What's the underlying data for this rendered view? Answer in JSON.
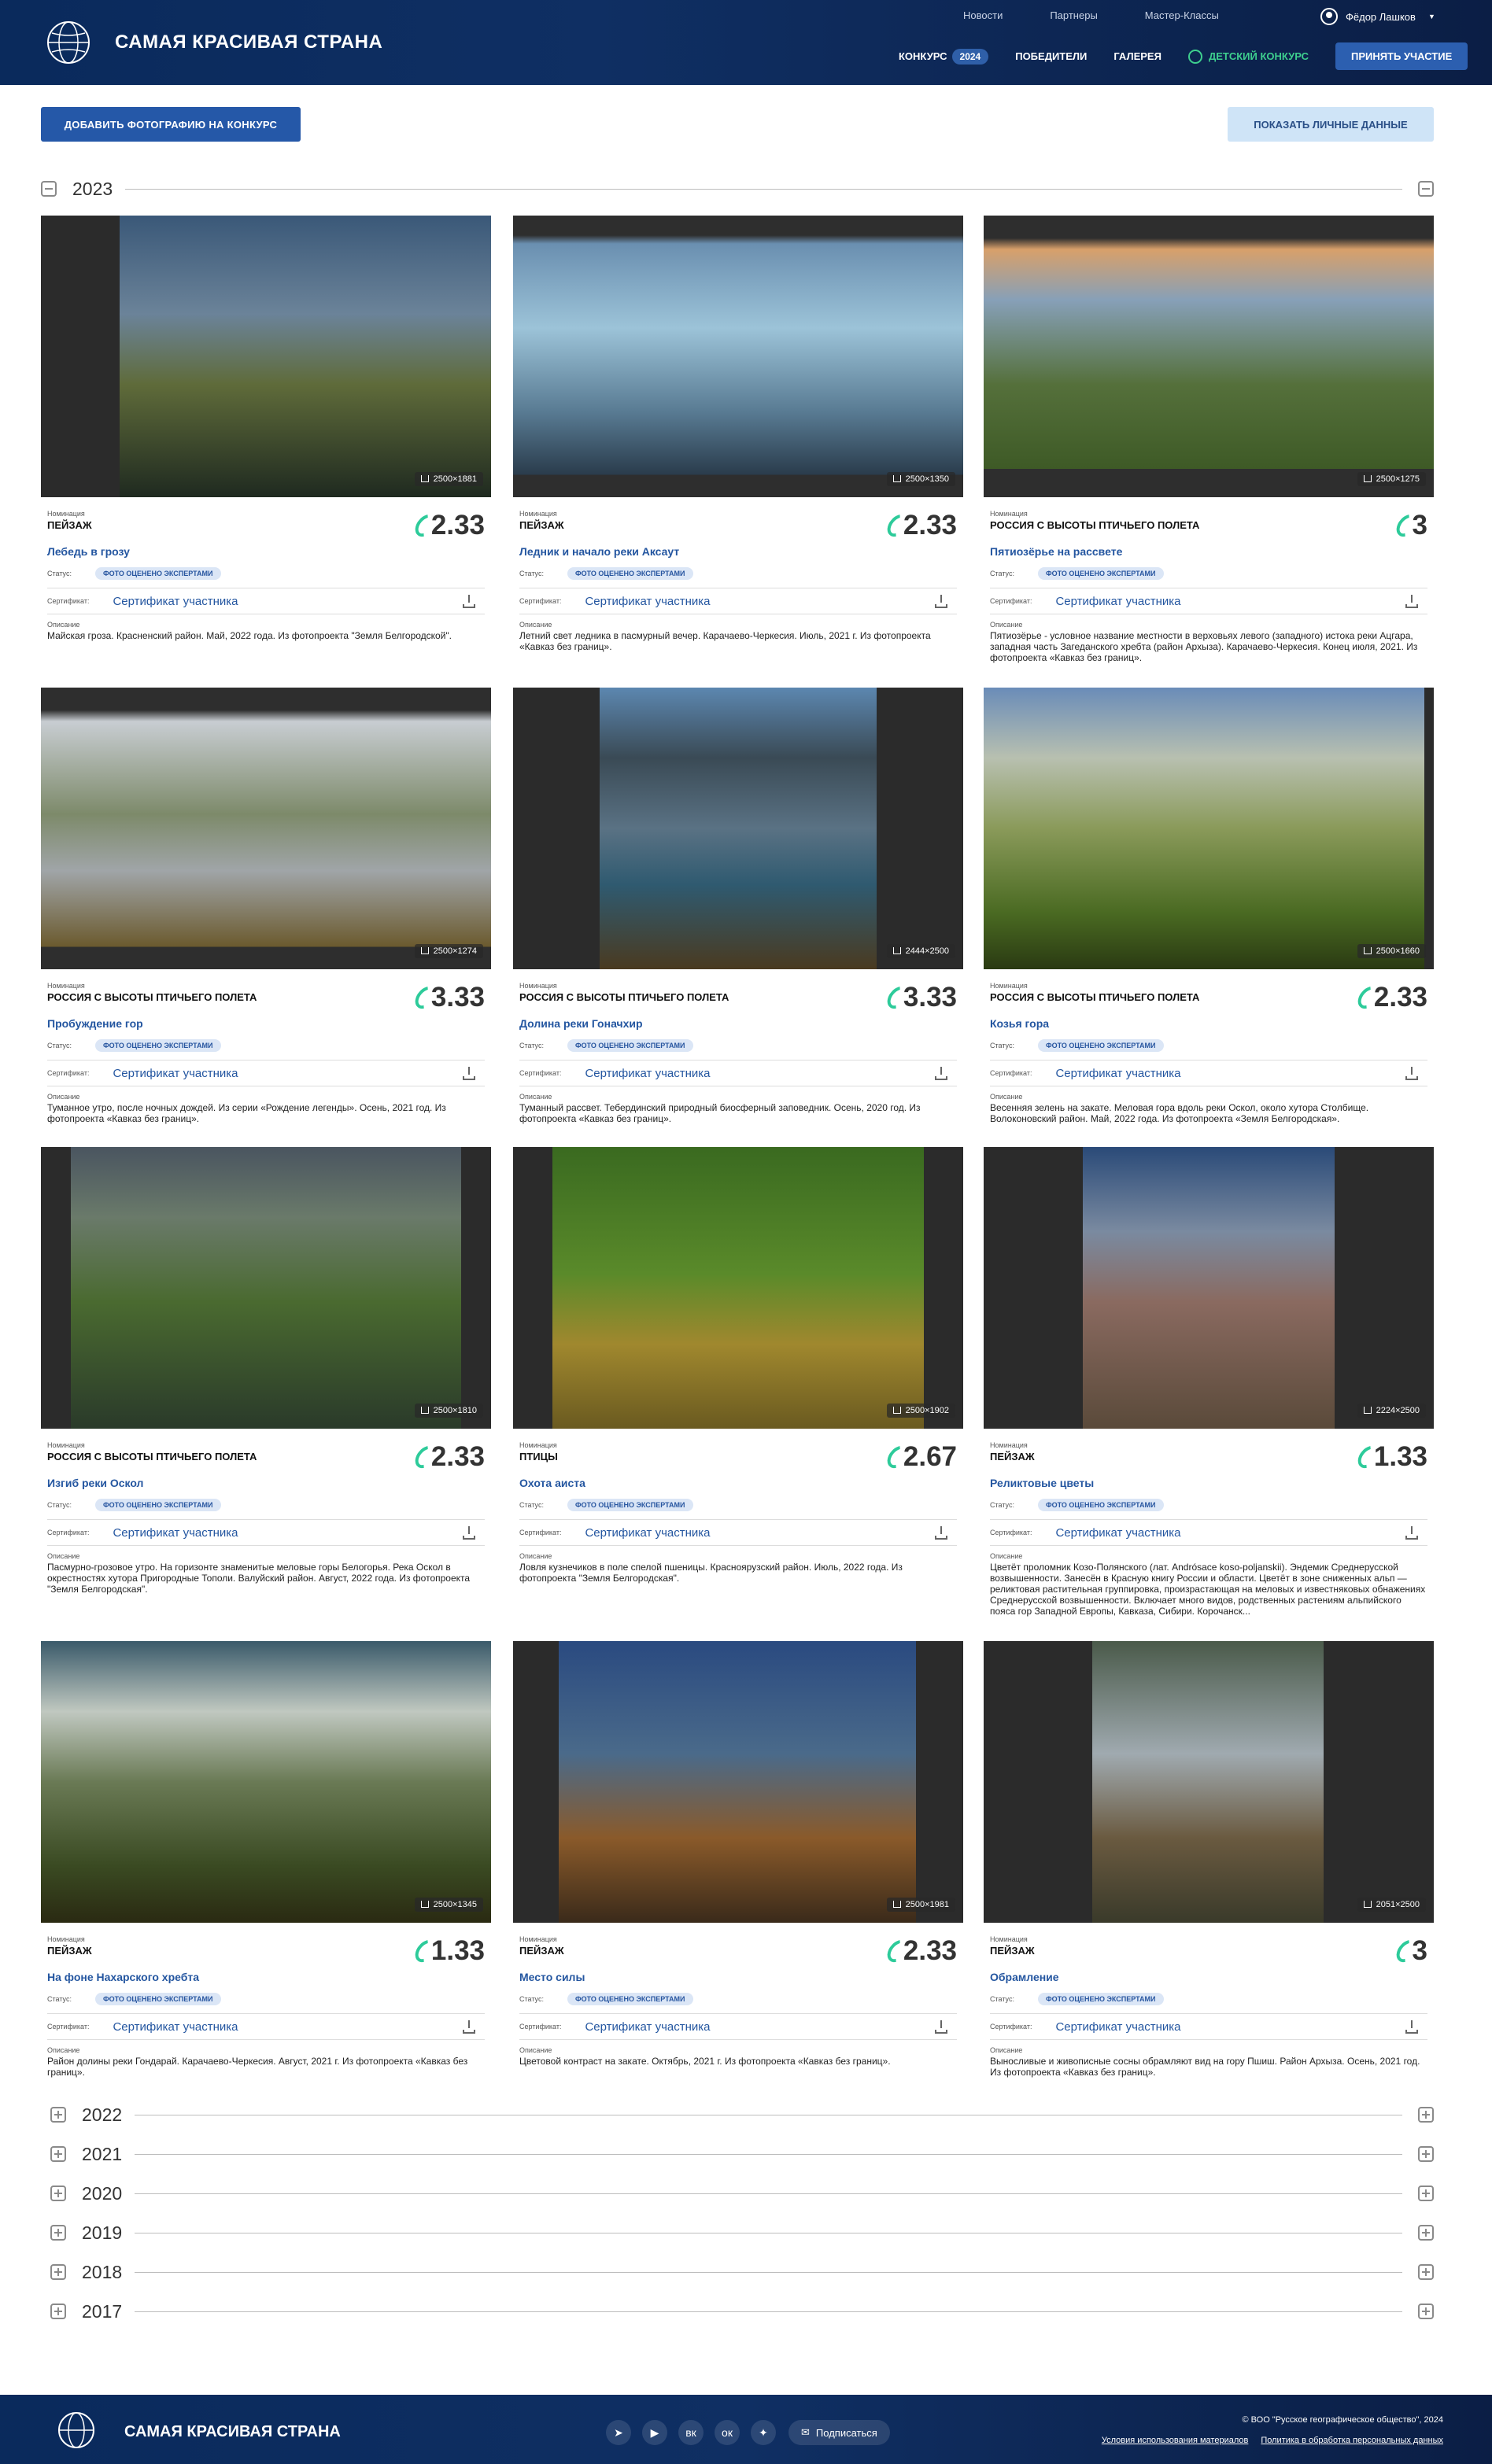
{
  "header": {
    "brand": "САМАЯ КРАСИВАЯ СТРАНА",
    "top_links": [
      "Новости",
      "Партнеры",
      "Мастер-Классы"
    ],
    "user_name": "Фёдор Лашков",
    "nav": {
      "contest": "КОНКУРС",
      "contest_year": "2024",
      "winners": "ПОБЕДИТЕЛИ",
      "gallery": "ГАЛЕРЕЯ",
      "kids": "ДЕТСКИЙ КОНКУРС",
      "join": "ПРИНЯТЬ УЧАСТИЕ"
    }
  },
  "actions": {
    "add_photo": "ДОБАВИТЬ ФОТОГРАФИЮ НА КОНКУРС",
    "show_personal": "ПОКАЗАТЬ ЛИЧНЫЕ ДАННЫЕ"
  },
  "labels": {
    "nomination": "Номинация",
    "status": "Статус:",
    "certificate": "Сертификат:",
    "certificate_link": "Сертификат участника",
    "description": "Описание"
  },
  "open_year": "2023",
  "photos": [
    {
      "res": "2500×1881",
      "nomination": "ПЕЙЗАЖ",
      "score": "2.33",
      "title": "Лебедь в грозу",
      "status": "ФОТО ОЦЕНЕНО ЭКСПЕРТАМИ",
      "desc": "Майская гроза. Красненский район. Май, 2022 года. Из фотопроекта \"Земля Белгородской\"."
    },
    {
      "res": "2500×1350",
      "nomination": "ПЕЙЗАЖ",
      "score": "2.33",
      "title": "Ледник и начало реки Аксаут",
      "status": "ФОТО ОЦЕНЕНО ЭКСПЕРТАМИ",
      "desc": "Летний свет ледника в пасмурный вечер. Карачаево-Черкесия. Июль, 2021 г. Из фотопроекта «Кавказ без границ»."
    },
    {
      "res": "2500×1275",
      "nomination": "РОССИЯ С ВЫСОТЫ ПТИЧЬЕГО ПОЛЕТА",
      "score": "3",
      "title": "Пятиозёрье на рассвете",
      "status": "ФОТО ОЦЕНЕНО ЭКСПЕРТАМИ",
      "desc": "Пятиозёрье - условное название местности в верховьях левого (западного) истока реки Ацгара, западная часть Загеданского хребта (район Архыза). Карачаево-Черкесия. Конец июля, 2021. Из фотопроекта «Кавказ без границ»."
    },
    {
      "res": "2500×1274",
      "nomination": "РОССИЯ С ВЫСОТЫ ПТИЧЬЕГО ПОЛЕТА",
      "score": "3.33",
      "title": "Пробуждение гор",
      "status": "ФОТО ОЦЕНЕНО ЭКСПЕРТАМИ",
      "desc": "Туманное утро, после ночных дождей. Из серии «Рождение легенды». Осень, 2021 год. Из фотопроекта «Кавказ без границ»."
    },
    {
      "res": "2444×2500",
      "nomination": "РОССИЯ С ВЫСОТЫ ПТИЧЬЕГО ПОЛЕТА",
      "score": "3.33",
      "title": "Долина реки Гоначхир",
      "status": "ФОТО ОЦЕНЕНО ЭКСПЕРТАМИ",
      "desc": "Туманный рассвет. Тебердинский природный биосферный заповедник. Осень, 2020 год. Из фотопроекта «Кавказ без границ»."
    },
    {
      "res": "2500×1660",
      "nomination": "РОССИЯ С ВЫСОТЫ ПТИЧЬЕГО ПОЛЕТА",
      "score": "2.33",
      "title": "Козья гора",
      "status": "ФОТО ОЦЕНЕНО ЭКСПЕРТАМИ",
      "desc": "Весенняя зелень на закате. Меловая гора вдоль реки Оскол, около хутора Столбище. Волоконовский район. Май, 2022 года. Из фотопроекта «Земля Белгородская»."
    },
    {
      "res": "2500×1810",
      "nomination": "РОССИЯ С ВЫСОТЫ ПТИЧЬЕГО ПОЛЕТА",
      "score": "2.33",
      "title": "Изгиб реки Оскол",
      "status": "ФОТО ОЦЕНЕНО ЭКСПЕРТАМИ",
      "desc": "Пасмурно-грозовое утро. На горизонте знаменитые меловые горы Белогорья. Река Оскол в окрестностях хутора Пригородные Тополи. Валуйский район. Август, 2022 года. Из фотопроекта \"Земля Белгородская\"."
    },
    {
      "res": "2500×1902",
      "nomination": "ПТИЦЫ",
      "score": "2.67",
      "title": "Охота аиста",
      "status": "ФОТО ОЦЕНЕНО ЭКСПЕРТАМИ",
      "desc": "Ловля кузнечиков в поле спелой пшеницы. Красноярузский район. Июль, 2022 года. Из фотопроекта \"Земля Белгородская\"."
    },
    {
      "res": "2224×2500",
      "nomination": "ПЕЙЗАЖ",
      "score": "1.33",
      "title": "Реликтовые цветы",
      "status": "ФОТО ОЦЕНЕНО ЭКСПЕРТАМИ",
      "desc": "Цветёт проломник Козо-Полянского (лат. Andrósace koso-poljanskii). Эндемик Среднерусской возвышенности. Занесён в Красную книгу России и области. Цветёт в зоне сниженных альп — реликтовая растительная группировка, произрастающая на меловых и известняковых обнажениях Среднерусской возвышенности. Включает много видов, родственных растениям альпийского пояса гор Западной Европы, Кавказа, Сибири. Корочанск..."
    },
    {
      "res": "2500×1345",
      "nomination": "ПЕЙЗАЖ",
      "score": "1.33",
      "title": "На фоне Нахарского хребта",
      "status": "ФОТО ОЦЕНЕНО ЭКСПЕРТАМИ",
      "desc": "Район долины реки Гондарай. Карачаево-Черкесия. Август, 2021 г. Из фотопроекта «Кавказ без границ»."
    },
    {
      "res": "2500×1981",
      "nomination": "ПЕЙЗАЖ",
      "score": "2.33",
      "title": "Место силы",
      "status": "ФОТО ОЦЕНЕНО ЭКСПЕРТАМИ",
      "desc": "Цветовой контраст на закате. Октябрь, 2021 г. Из фотопроекта «Кавказ без границ»."
    },
    {
      "res": "2051×2500",
      "nomination": "ПЕЙЗАЖ",
      "score": "3",
      "title": "Обрамление",
      "status": "ФОТО ОЦЕНЕНО ЭКСПЕРТАМИ",
      "desc": "Выносливые и живописные сосны обрамляют вид на гору Пшиш. Район Архыза. Осень, 2021 год. Из фотопроекта «Кавказ без границ»."
    }
  ],
  "other_years": [
    "2022",
    "2021",
    "2020",
    "2019",
    "2018",
    "2017"
  ],
  "footer": {
    "brand": "САМАЯ КРАСИВАЯ СТРАНА",
    "social_icons": [
      "telegram-icon",
      "youtube-icon",
      "vk-icon",
      "ok-icon",
      "dzen-icon"
    ],
    "subscribe": "Подписаться",
    "copyright": "© ВОО \"Русское географическое общество\", 2024",
    "terms": "Условия использования материалов",
    "privacy": "Политика в обработка персональных данных"
  }
}
